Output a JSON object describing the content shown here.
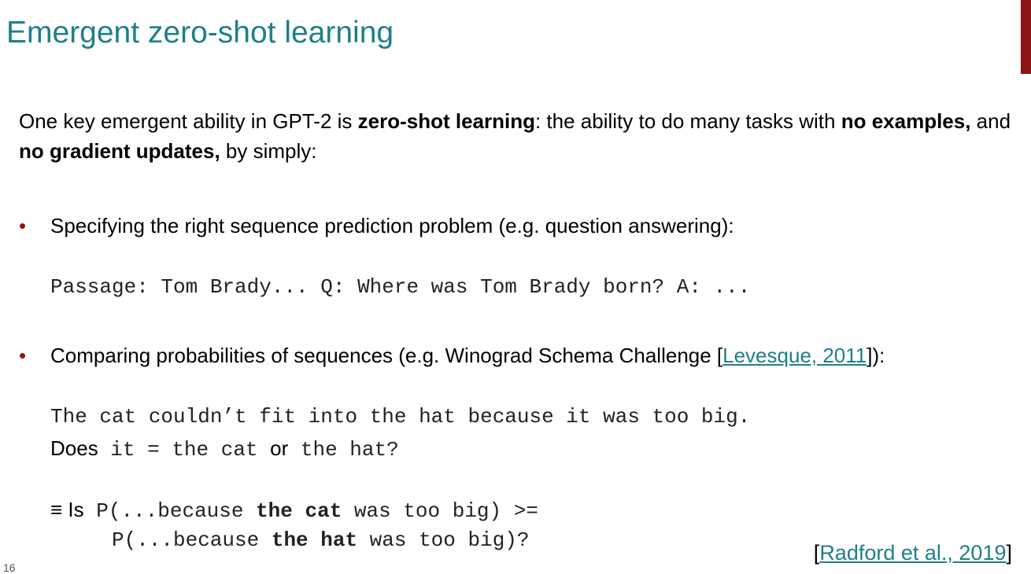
{
  "slide": {
    "title": "Emergent zero-shot learning",
    "page_number": "16",
    "accent_color": "#8c1515",
    "title_color": "#1f7f8a"
  },
  "intro": {
    "t1": "One key emergent ability in GPT-2 is ",
    "b1": "zero-shot learning",
    "t2": ": the ability to do many tasks with ",
    "b2": "no examples,",
    "t3": " and ",
    "b3": "no gradient updates,",
    "t4": " by simply:"
  },
  "bullet1": {
    "marker": "•",
    "text": "Specifying the right sequence prediction problem (e.g. question answering):",
    "example": "Passage: Tom Brady... Q: Where was Tom Brady born? A: ..."
  },
  "bullet2": {
    "marker": "•",
    "text_before": "Comparing probabilities of sequences (e.g. Winograd Schema Challenge [",
    "link": "Levesque, 2011",
    "text_after": "]):",
    "example_line1": "The cat couldn’t fit into the hat because it was too big.",
    "does_label": "Does",
    "example_line2_a": " it = the cat ",
    "or_label": "or",
    "example_line2_b": " the hat?"
  },
  "equiv": {
    "symbol": "≡",
    "is_label": "Is",
    "line1_a": " P(...because ",
    "line1_bold": "the cat",
    "line1_b": " was too big) >=",
    "line2_a": "P(...because ",
    "line2_bold": "the hat",
    "line2_b": " was too big)?"
  },
  "citation": {
    "open": "[",
    "link": "Radford et al., 2019",
    "close": "]"
  }
}
